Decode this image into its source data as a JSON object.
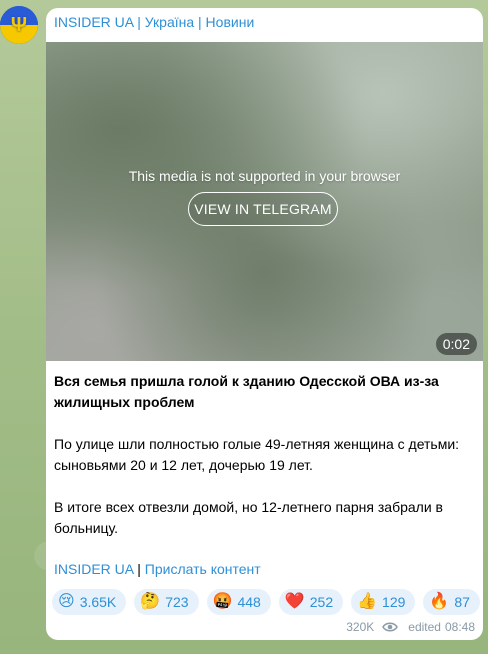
{
  "channel": {
    "name": "INSIDER UA | Україна | Новини"
  },
  "media": {
    "message": "This media is not supported in your browser",
    "button_label": "VIEW IN TELEGRAM",
    "duration": "0:02"
  },
  "post": {
    "headline": "Вся семья пришла голой к зданию Одесской ОВА из-за жилищных проблем",
    "paragraph1": "По улице шли полностью голые 49-летняя женщина с детьми: сыновьями 20 и 12 лет, дочерью 19 лет.",
    "paragraph2": "В итоге всех отвезли домой, но 12-летнего парня забрали в больницу."
  },
  "links": {
    "channel_link": "INSIDER UA",
    "separator": "|",
    "submit_link": "Прислать контент"
  },
  "reactions": [
    {
      "emoji": "😢",
      "count": "3.65K"
    },
    {
      "emoji": "🤔",
      "count": "723"
    },
    {
      "emoji": "🤬",
      "count": "448"
    },
    {
      "emoji": "❤️",
      "count": "252"
    },
    {
      "emoji": "👍",
      "count": "129"
    },
    {
      "emoji": "🔥",
      "count": "87"
    }
  ],
  "meta": {
    "views": "320K",
    "edited_label": "edited",
    "time": "08:48"
  },
  "colors": {
    "link": "#2f8fd6",
    "reaction_bg": "#e6f1fb",
    "meta": "#8a9aa6"
  }
}
